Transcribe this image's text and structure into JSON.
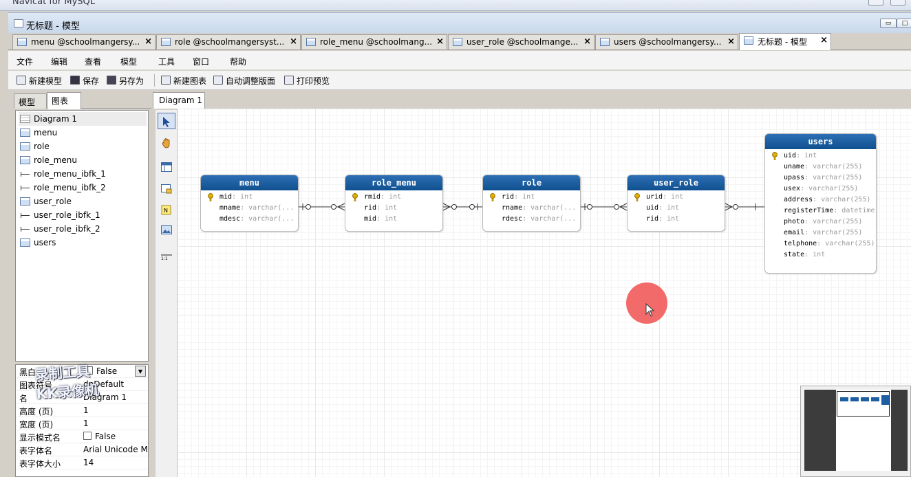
{
  "app": {
    "title": "Navicat for MySQL"
  },
  "window": {
    "title": "无标题 - 模型"
  },
  "doc_tabs": [
    {
      "label": "menu @schoolmangersy...",
      "icon": "table-icon"
    },
    {
      "label": "role @schoolmangersyst...",
      "icon": "table-icon"
    },
    {
      "label": "role_menu @schoolmang...",
      "icon": "table-icon"
    },
    {
      "label": "user_role @schoolmange...",
      "icon": "table-icon"
    },
    {
      "label": "users @schoolmangersy...",
      "icon": "table-icon"
    },
    {
      "label": "无标题 - 模型",
      "icon": "model-icon"
    }
  ],
  "menu": [
    "文件",
    "编辑",
    "查看",
    "模型",
    "工具",
    "窗口",
    "帮助"
  ],
  "toolbar": {
    "new_model": "新建模型",
    "save": "保存",
    "save_as": "另存为",
    "new_diagram": "新建图表",
    "auto_layout": "自动调整版面",
    "print_preview": "打印预览"
  },
  "left_tabs": {
    "model": "模型",
    "diagram": "图表"
  },
  "tree": [
    {
      "label": "Diagram 1",
      "type": "diagram"
    },
    {
      "label": "menu",
      "type": "table"
    },
    {
      "label": "role",
      "type": "table"
    },
    {
      "label": "role_menu",
      "type": "table"
    },
    {
      "label": "role_menu_ibfk_1",
      "type": "fk"
    },
    {
      "label": "role_menu_ibfk_2",
      "type": "fk"
    },
    {
      "label": "user_role",
      "type": "table"
    },
    {
      "label": "user_role_ibfk_1",
      "type": "fk"
    },
    {
      "label": "user_role_ibfk_2",
      "type": "fk"
    },
    {
      "label": "users",
      "type": "table"
    }
  ],
  "properties": [
    {
      "key": "黑白",
      "value": "False",
      "checkbox": true,
      "dropdown": true
    },
    {
      "key": "图表符号",
      "value": "dnDefault"
    },
    {
      "key": "名",
      "value": "Diagram 1"
    },
    {
      "key": "高度 (页)",
      "value": "1"
    },
    {
      "key": "宽度 (页)",
      "value": "1"
    },
    {
      "key": "显示模式名",
      "value": "False",
      "checkbox": true
    },
    {
      "key": "表字体名",
      "value": "Arial Unicode MS"
    },
    {
      "key": "表字体大小",
      "value": "14"
    }
  ],
  "watermark": [
    "录制工具",
    "KK录像机"
  ],
  "canvas_tab": "Diagram 1",
  "palette": [
    "pointer-icon",
    "hand-icon",
    "table-icon",
    "view-icon",
    "note-icon",
    "image-icon",
    "relation-icon"
  ],
  "er_tables": {
    "menu": {
      "name": "menu",
      "fields": [
        {
          "name": "mid",
          "type": "int",
          "pk": true
        },
        {
          "name": "mname",
          "type": "varchar(...",
          "pk": false
        },
        {
          "name": "mdesc",
          "type": "varchar(...",
          "pk": false
        }
      ]
    },
    "role_menu": {
      "name": "role_menu",
      "fields": [
        {
          "name": "rmid",
          "type": "int",
          "pk": true
        },
        {
          "name": "rid",
          "type": "int",
          "pk": false
        },
        {
          "name": "mid",
          "type": "int",
          "pk": false
        }
      ]
    },
    "role": {
      "name": "role",
      "fields": [
        {
          "name": "rid",
          "type": "int",
          "pk": true
        },
        {
          "name": "rname",
          "type": "varchar(...",
          "pk": false
        },
        {
          "name": "rdesc",
          "type": "varchar(...",
          "pk": false
        }
      ]
    },
    "user_role": {
      "name": "user_role",
      "fields": [
        {
          "name": "urid",
          "type": "int",
          "pk": true
        },
        {
          "name": "uid",
          "type": "int",
          "pk": false
        },
        {
          "name": "rid",
          "type": "int",
          "pk": false
        }
      ]
    },
    "users": {
      "name": "users",
      "fields": [
        {
          "name": "uid",
          "type": "int",
          "pk": true
        },
        {
          "name": "uname",
          "type": "varchar(255)",
          "pk": false
        },
        {
          "name": "upass",
          "type": "varchar(255)",
          "pk": false
        },
        {
          "name": "usex",
          "type": "varchar(255)",
          "pk": false
        },
        {
          "name": "address",
          "type": "varchar(255)",
          "pk": false
        },
        {
          "name": "registerTime",
          "type": "datetime",
          "pk": false
        },
        {
          "name": "photo",
          "type": "varchar(255)",
          "pk": false
        },
        {
          "name": "email",
          "type": "varchar(255)",
          "pk": false
        },
        {
          "name": "telphone",
          "type": "varchar(255)",
          "pk": false
        },
        {
          "name": "state",
          "type": "int",
          "pk": false
        }
      ]
    }
  },
  "colors": {
    "table_header": "#10508f",
    "cursor_highlight": "#f05050",
    "pk_key": "#e0b000"
  }
}
